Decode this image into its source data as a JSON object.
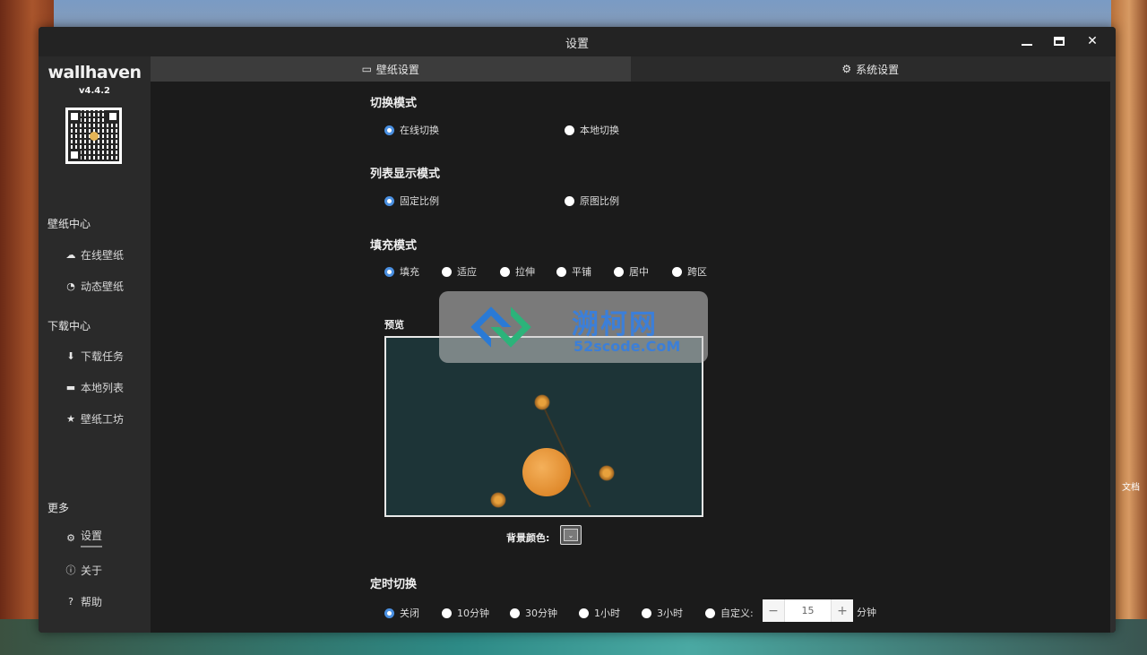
{
  "window": {
    "title": "设置"
  },
  "sidebar": {
    "app_name": "wallhaven",
    "version": "v4.4.2",
    "sections": [
      {
        "title": "壁纸中心",
        "items": [
          {
            "label": "在线壁纸",
            "icon": "cloud-icon"
          },
          {
            "label": "动态壁纸",
            "icon": "gauge-icon"
          }
        ]
      },
      {
        "title": "下载中心",
        "items": [
          {
            "label": "下载任务",
            "icon": "download-tray-icon"
          },
          {
            "label": "本地列表",
            "icon": "folder-open-icon"
          },
          {
            "label": "壁纸工坊",
            "icon": "star-magic-icon"
          }
        ]
      },
      {
        "title": "更多",
        "items": [
          {
            "label": "设置",
            "icon": "gear-icon",
            "active": true
          },
          {
            "label": "关于",
            "icon": "info-icon"
          },
          {
            "label": "帮助",
            "icon": "question-icon"
          }
        ]
      }
    ]
  },
  "tabs": [
    {
      "label": "壁纸设置",
      "icon": "monitor-icon",
      "active": true
    },
    {
      "label": "系统设置",
      "icon": "gear-outline-icon",
      "active": false
    }
  ],
  "settings": {
    "switch_mode": {
      "title": "切换模式",
      "options": [
        {
          "label": "在线切换",
          "checked": true
        },
        {
          "label": "本地切换",
          "checked": false
        }
      ]
    },
    "list_mode": {
      "title": "列表显示模式",
      "options": [
        {
          "label": "固定比例",
          "checked": true
        },
        {
          "label": "原图比例",
          "checked": false
        }
      ]
    },
    "fill_mode": {
      "title": "填充模式",
      "options": [
        {
          "label": "填充",
          "checked": true
        },
        {
          "label": "适应",
          "checked": false
        },
        {
          "label": "拉伸",
          "checked": false
        },
        {
          "label": "平铺",
          "checked": false
        },
        {
          "label": "居中",
          "checked": false
        },
        {
          "label": "跨区",
          "checked": false
        }
      ],
      "preview_label": "预览",
      "bg_color_label": "背景颜色:"
    },
    "timer": {
      "title": "定时切换",
      "options": [
        {
          "label": "关闭",
          "checked": true
        },
        {
          "label": "10分钟",
          "checked": false
        },
        {
          "label": "30分钟",
          "checked": false
        },
        {
          "label": "1小时",
          "checked": false
        },
        {
          "label": "3小时",
          "checked": false
        },
        {
          "label": "自定义:",
          "checked": false
        }
      ],
      "custom_value": "15",
      "custom_unit": "分钟",
      "minus": "−",
      "plus": "+"
    }
  },
  "watermark": {
    "title": "溯柯网",
    "subtitle": "52scode.CoM"
  },
  "desktop": {
    "icon_label": "文档"
  },
  "colors": {
    "accent": "#4a90e2",
    "window_bg": "#1b1b1b",
    "sidebar_bg": "#2a2a2a"
  }
}
